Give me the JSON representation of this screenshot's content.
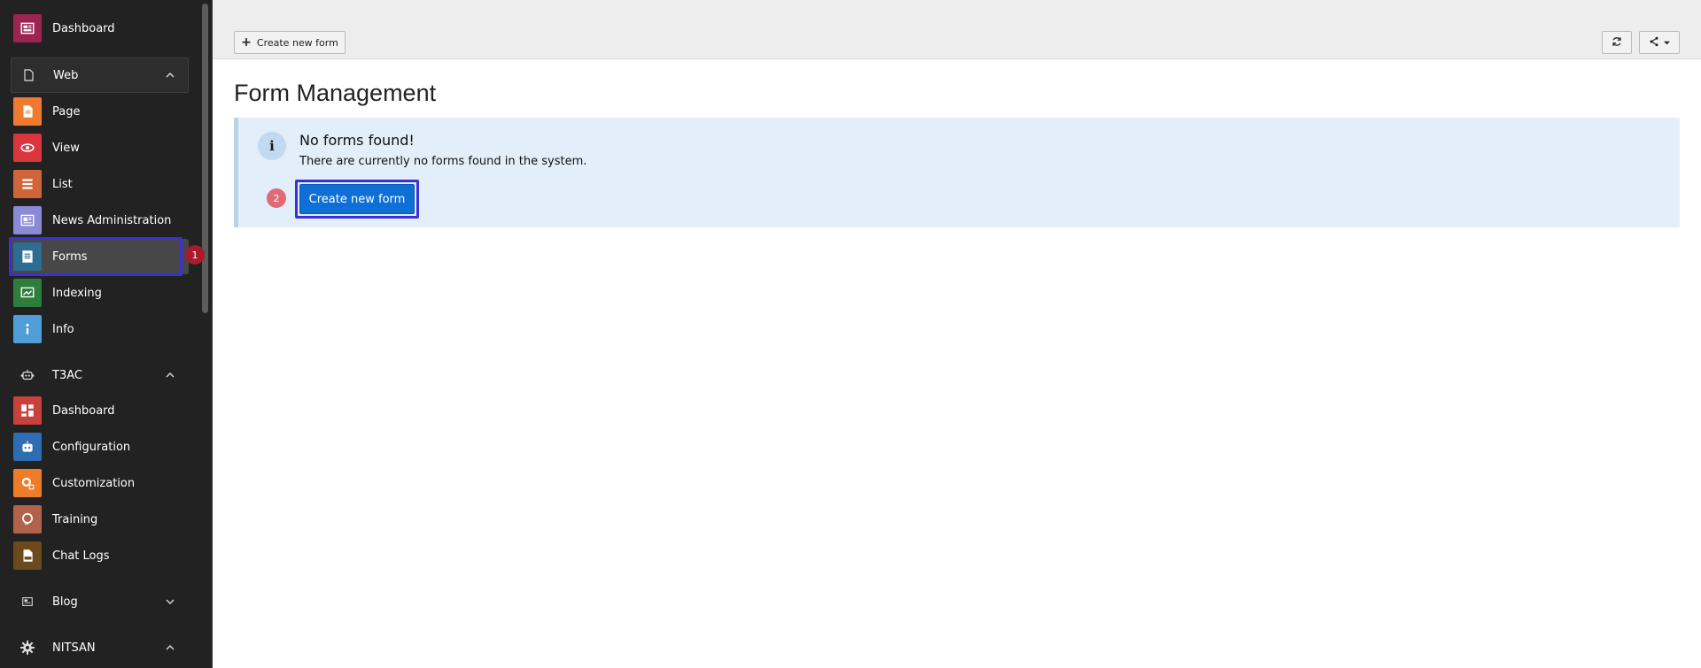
{
  "sidebar": {
    "dashboard": "Dashboard",
    "web": {
      "label": "Web",
      "items": [
        "Page",
        "View",
        "List",
        "News Administration",
        "Forms",
        "Indexing",
        "Info"
      ]
    },
    "t3ac": {
      "label": "T3AC",
      "items": [
        "Dashboard",
        "Configuration",
        "Customization",
        "Training",
        "Chat Logs"
      ]
    },
    "blog": "Blog",
    "nitsan": "NITSAN",
    "forms_badge": "1"
  },
  "topbar": {
    "create_label": "Create new form"
  },
  "main": {
    "title": "Form Management",
    "info_title": "No forms found!",
    "info_text": "There are currently no forms found in the system.",
    "create_button": "Create new form",
    "step_badge": "2"
  },
  "colors": {
    "highlight": "#3b2fd6",
    "primary": "#0e6fd6",
    "badge1": "#a81b2c",
    "badge2": "#e06b78"
  }
}
